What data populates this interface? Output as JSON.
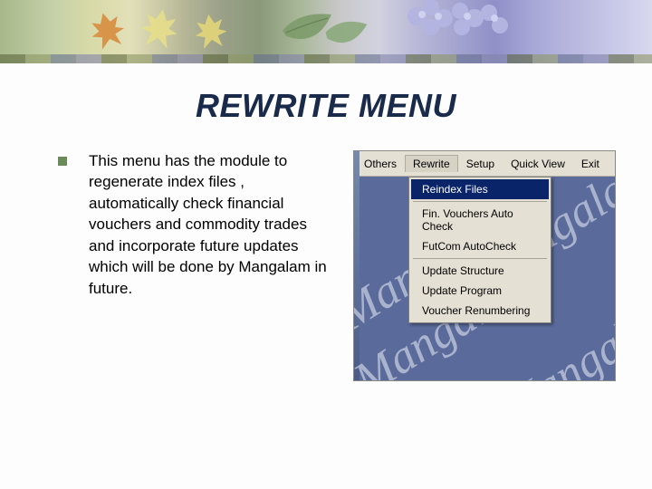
{
  "slide": {
    "title": "REWRITE MENU",
    "bullet_text": "This menu has the module to regenerate index files , automatically check financial vouchers and commodity trades and incorporate future updates which will be done by Mangalam in future."
  },
  "app": {
    "menubar": {
      "others": "Others",
      "rewrite": "Rewrite",
      "setup": "Setup",
      "quickview": "Quick View",
      "exit": "Exit"
    },
    "dropdown": {
      "reindex": "Reindex Files",
      "fin_vouchers": "Fin. Vouchers Auto Check",
      "futcom": "FutCom AutoCheck",
      "update_structure": "Update Structure",
      "update_program": "Update Program",
      "voucher_renum": "Voucher Renumbering"
    },
    "watermark": "Mangalam"
  }
}
